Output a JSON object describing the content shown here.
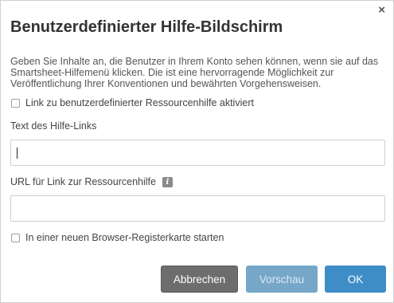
{
  "dialog": {
    "close_glyph": "×",
    "title": "Benutzerdefinierter Hilfe-Bildschirm",
    "description": "Geben Sie Inhalte an, die Benutzer in Ihrem Konto sehen können, wenn sie auf das Smartsheet-Hilfemenü klicken. Die ist eine hervorragende Möglichkeit zur Veröffentlichung Ihrer Konventionen und bewährten Vorgehensweisen.",
    "enable_checkbox_label": "Link zu benutzerdefinierter Ressourcenhilfe aktiviert",
    "enable_checked": false,
    "help_link_text_label": "Text des Hilfe-Links",
    "help_link_text_value": "",
    "resource_url_label": "URL für Link zur Ressourcenhilfe",
    "info_icon_glyph": "i",
    "resource_url_value": "",
    "new_tab_checkbox_label": "In einer neuen Browser-Registerkarte starten",
    "new_tab_checked": false,
    "buttons": {
      "cancel": "Abbrechen",
      "preview": "Vorschau",
      "ok": "OK"
    },
    "colors": {
      "cancel_button": "#6d6d6d",
      "preview_button": "#76a7c9",
      "ok_button": "#3f8dc7"
    }
  }
}
